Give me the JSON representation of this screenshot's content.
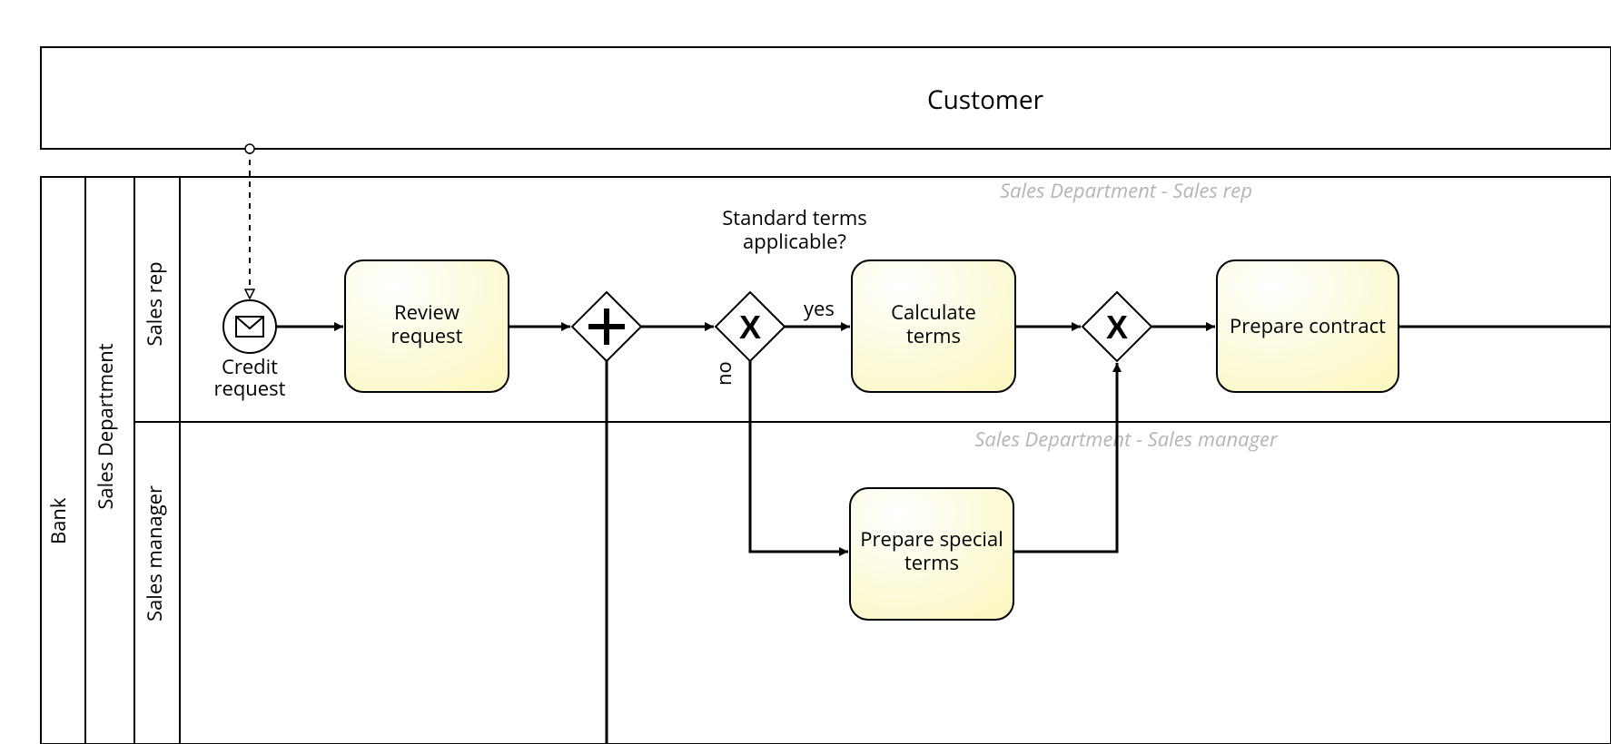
{
  "pools": {
    "customer": {
      "title": "Customer"
    },
    "bank": {
      "title": "Bank"
    }
  },
  "lanes": {
    "sales_department": {
      "title": "Sales Department"
    },
    "sales_rep": {
      "title": "Sales rep",
      "watermark": "Sales Department - Sales rep"
    },
    "sales_manager": {
      "title": "Sales manager",
      "watermark": "Sales Department - Sales manager"
    }
  },
  "events": {
    "credit_request": {
      "label": "Credit\nrequest"
    }
  },
  "tasks": {
    "review_request": {
      "label": "Review\nrequest"
    },
    "calculate_terms": {
      "label": "Calculate\nterms"
    },
    "prepare_special_terms": {
      "label": "Prepare special\nterms"
    },
    "prepare_contract": {
      "label": "Prepare contract"
    }
  },
  "gateways": {
    "parallel": {
      "symbol": "+"
    },
    "exclusive_split": {
      "label": "Standard terms\napplicable?",
      "yes": "yes",
      "no": "no"
    },
    "exclusive_merge": {}
  }
}
